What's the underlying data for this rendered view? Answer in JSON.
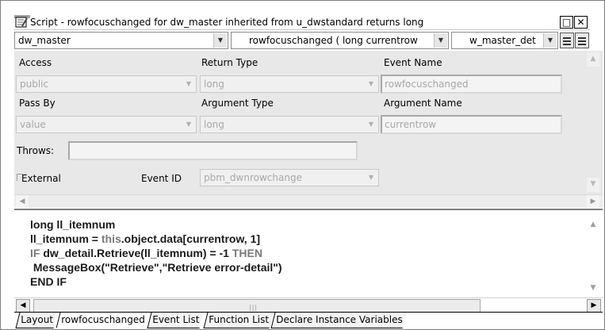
{
  "window": {
    "title": "Script - rowfocuschanged for dw_master inherited from u_dwstandard returns long",
    "maximize_glyph": "□",
    "close_glyph": "✕"
  },
  "header": {
    "object_combo": "dw_master",
    "event_combo": "rowfocuschanged ( long currentrow",
    "ancestor_combo": "w_master_det"
  },
  "properties": {
    "access_label": "Access",
    "access_value": "public",
    "return_type_label": "Return Type",
    "return_type_value": "long",
    "event_name_label": "Event Name",
    "event_name_value": "rowfocuschanged",
    "pass_by_label": "Pass By",
    "pass_by_value": "value",
    "argument_type_label": "Argument Type",
    "argument_type_value": "long",
    "argument_name_label": "Argument Name",
    "argument_name_value": "currentrow",
    "throws_label": "Throws:",
    "throws_value": "",
    "external_label": "External",
    "event_id_label": "Event ID",
    "event_id_value": "pbm_dwnrowchange"
  },
  "code": {
    "line1": "long ll_itemnum",
    "line2_a": "ll_itemnum = ",
    "line2_kw": "this",
    "line2_b": ".object.data[currentrow, 1]",
    "line3_kw1": "IF",
    "line3_mid": " dw_detail.Retrieve(ll_itemnum) = -1 ",
    "line3_kw2": "THEN",
    "line4": " MessageBox(\"Retrieve\",\"Retrieve error-detail\")",
    "line5": "END IF"
  },
  "tabs": [
    {
      "label": "Layout"
    },
    {
      "label": "rowfocuschanged"
    },
    {
      "label": "Event List"
    },
    {
      "label": "Function List"
    },
    {
      "label": "Declare Instance Variables"
    }
  ],
  "icons": {
    "script": "script-icon",
    "dropdown": "chevron-down-icon",
    "scroll_up": "arrow-up-icon",
    "scroll_down": "arrow-down-icon",
    "scroll_left": "arrow-left-icon",
    "scroll_right": "arrow-right-icon",
    "layout_toggle": "layout-toggle-icon"
  },
  "colors": {
    "panel": "#e8e8e8",
    "disabled_text": "#a8a8a8",
    "keyword": "#7a7a7a"
  }
}
